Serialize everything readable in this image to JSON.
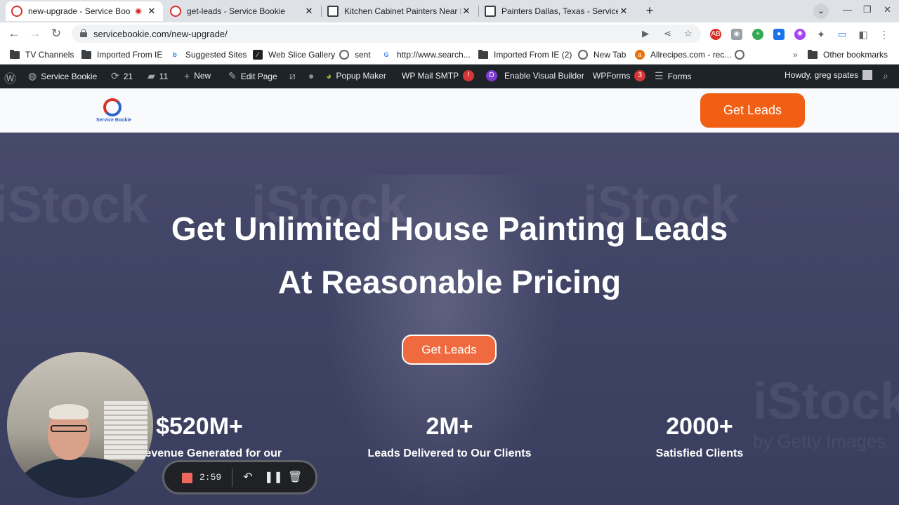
{
  "browser": {
    "tabs": [
      {
        "title": "new-upgrade - Service Booki",
        "active": true,
        "recording": true
      },
      {
        "title": "get-leads - Service Bookie",
        "active": false
      },
      {
        "title": "Kitchen Cabinet Painters Near M",
        "active": false
      },
      {
        "title": "Painters Dallas, Texas - Service H",
        "active": false
      }
    ],
    "new_tab": "+",
    "url": "servicebookie.com/new-upgrade/"
  },
  "bookmarks": [
    {
      "label": "TV Channels",
      "icon": "folder-icon"
    },
    {
      "label": "Imported From IE",
      "icon": "folder-icon"
    },
    {
      "label": "Suggested Sites",
      "icon": "bing-icon"
    },
    {
      "label": "Web Slice Gallery",
      "icon": "slice-icon"
    },
    {
      "label": "sent",
      "icon": "globe-icon"
    },
    {
      "label": "http://www.search...",
      "icon": "google-icon"
    },
    {
      "label": "Imported From IE (2)",
      "icon": "folder-icon"
    },
    {
      "label": "New Tab",
      "icon": "globe-icon"
    },
    {
      "label": "Allrecipes.com - rec...",
      "icon": "allrecipes-icon"
    },
    {
      "label": "Other bookmarks",
      "icon": "folder-icon"
    }
  ],
  "wp_admin": {
    "site": "Service Bookie",
    "updates": "21",
    "comments": "11",
    "new": "New",
    "edit": "Edit Page",
    "popup": "Popup Maker",
    "smtp": "WP Mail SMTP",
    "smtp_badge": "!",
    "visual_builder": "Enable Visual Builder",
    "wpforms": "WPForms",
    "wpforms_badge": "3",
    "forms": "Forms",
    "howdy": "Howdy, greg spates"
  },
  "site": {
    "logo_text": "Service Bookie",
    "header_button": "Get Leads",
    "hero_line1": "Get Unlimited House Painting Leads",
    "hero_line2": "At Reasonable Pricing",
    "hero_button": "Get Leads",
    "stats": [
      {
        "value": "$520M+",
        "label": "Revenue Generated for our"
      },
      {
        "value": "2M+",
        "label": "Leads Delivered to Our Clients"
      },
      {
        "value": "2000+",
        "label": "Satisfied Clients"
      }
    ],
    "watermark": "iStock",
    "watermark_sub": "by Getty Images"
  },
  "recorder": {
    "time": "2:59"
  },
  "colors": {
    "accent_orange": "#f05f14",
    "wp_bar": "#1d2327",
    "hero_overlay": "#3f4364"
  }
}
